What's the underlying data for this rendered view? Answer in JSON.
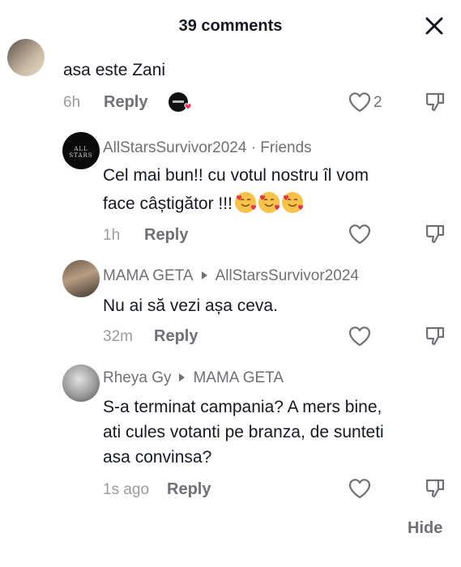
{
  "header": {
    "title": "39 comments"
  },
  "comments": [
    {
      "text": "asa este Zani",
      "time": "6h",
      "reply": "Reply",
      "likes": "2"
    },
    {
      "author": "AllStarsSurvivor2024 · Friends",
      "line1": "Cel mai bun!! cu votul nostru îl vom",
      "line2": "face câștigător !!!",
      "time": "1h",
      "reply": "Reply",
      "avatar_text": "ALL STARS"
    },
    {
      "author": "MAMA GETA",
      "reply_to": "AllStarsSurvivor2024",
      "text": "Nu ai să vezi așa ceva.",
      "time": "32m",
      "reply": "Reply"
    },
    {
      "author": "Rheya Gy",
      "reply_to": "MAMA GETA",
      "line1": "S-a terminat campania? A mers bine,",
      "line2": "ati cules votanti pe branza, de sunteti",
      "line3": "asa convinsa?",
      "time": "1s ago",
      "reply": "Reply"
    }
  ],
  "footer": {
    "hide": "Hide"
  },
  "icons": {
    "close": "close-icon",
    "like": "heart-outline-icon",
    "dislike": "thumbs-down-icon",
    "emoji": "smiling-face-with-hearts-emoji"
  },
  "colors": {
    "primary_text": "#161823",
    "secondary_text": "#6f7075",
    "muted_text": "#9a9ba1",
    "like_badge": "#fe2c55"
  }
}
